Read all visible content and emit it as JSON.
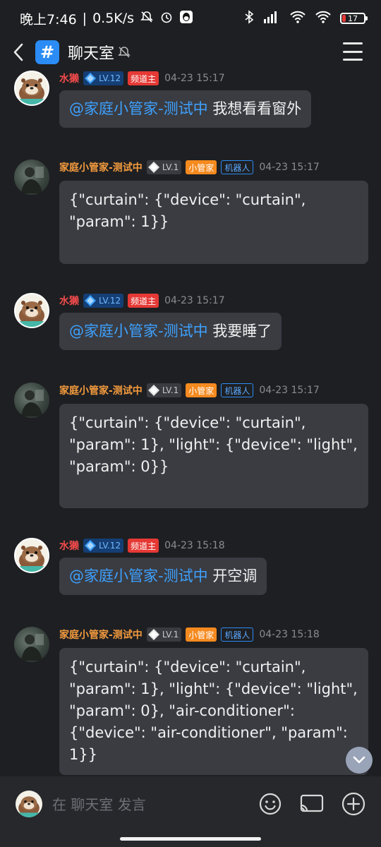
{
  "status_bar": {
    "time": "晚上7:46",
    "network_speed": "0.5K/s",
    "battery": "17",
    "battery_level": 0.17,
    "battery_color": "#e53935"
  },
  "header": {
    "title": "聊天室",
    "channel_icon": "#"
  },
  "messages": [
    {
      "sender": "水獭",
      "level": "LV.12",
      "role_tag": "频道主",
      "time": "04-23 15:17",
      "mention": "@家庭小管家-测试中",
      "text": " 我想看看窗外"
    },
    {
      "sender": "家庭小管家-测试中",
      "level": "LV.1",
      "role_tag": "小管家",
      "bot_tag": "机器人",
      "time": "04-23 15:17",
      "text": "{\"curtain\": {\"device\": \"curtain\", \"param\": 1}}"
    },
    {
      "sender": "水獭",
      "level": "LV.12",
      "role_tag": "频道主",
      "time": "04-23 15:17",
      "mention": "@家庭小管家-测试中",
      "text": " 我要睡了"
    },
    {
      "sender": "家庭小管家-测试中",
      "level": "LV.1",
      "role_tag": "小管家",
      "bot_tag": "机器人",
      "time": "04-23 15:17",
      "text": "{\"curtain\": {\"device\": \"curtain\", \"param\": 1}, \"light\": {\"device\": \"light\", \"param\": 0}}"
    },
    {
      "sender": "水獭",
      "level": "LV.12",
      "role_tag": "频道主",
      "time": "04-23 15:18",
      "mention": "@家庭小管家-测试中",
      "text": " 开空调"
    },
    {
      "sender": "家庭小管家-测试中",
      "level": "LV.1",
      "role_tag": "小管家",
      "bot_tag": "机器人",
      "time": "04-23 15:18",
      "text": "{\"curtain\": {\"device\": \"curtain\", \"param\": 1}, \"light\": {\"device\": \"light\", \"param\": 0}, \"air-conditioner\": {\"device\": \"air-conditioner\", \"param\": 1}}"
    }
  ],
  "input": {
    "placeholder": "在 聊天室 发言"
  },
  "colors": {
    "accent": "#2b8cf5",
    "owner_name": "#f04b4b",
    "bot_name": "#f39b3e",
    "mention": "#3ea1ff"
  },
  "icons": [
    "back-icon",
    "hash-icon",
    "bell-muted-icon",
    "menu-icon",
    "gem-icon",
    "scroll-down-icon",
    "emoji-icon",
    "screen-cast-icon",
    "add-icon"
  ]
}
